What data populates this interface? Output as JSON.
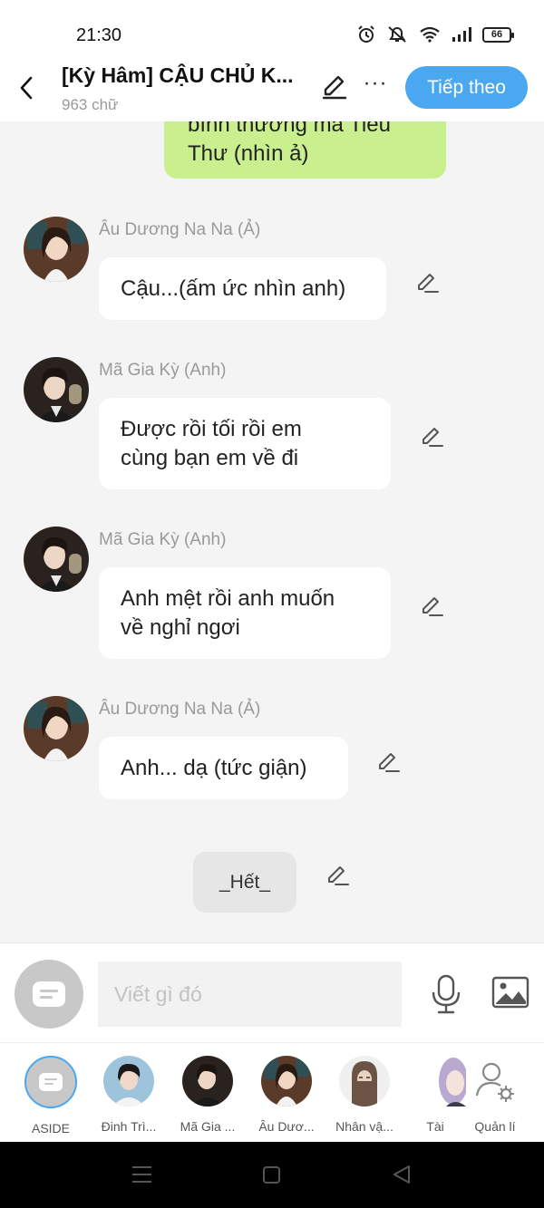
{
  "status_bar": {
    "time": "21:30",
    "battery": "66"
  },
  "header": {
    "title": "[Kỳ Hâm] CẬU CHỦ K...",
    "subtitle": "963 chữ",
    "next_label": "Tiếp theo"
  },
  "chat": {
    "partial_bubble_text_line1": "bình thường mà Tiểu",
    "partial_bubble_text_line2": "Thư (nhìn ả)",
    "messages": [
      {
        "name": "Âu Dương Na Na (Ả)",
        "text": "Cậu...(ấm ức nhìn anh)"
      },
      {
        "name": "Mã Gia Kỳ (Anh)",
        "text_line1": "Được rồi tối rồi em",
        "text_line2": "cùng bạn em về đi"
      },
      {
        "name": "Mã Gia Kỳ (Anh)",
        "text_line1": "Anh mệt rồi anh muốn",
        "text_line2": "về nghỉ ngơi"
      },
      {
        "name": "Âu Dương Na Na (Ả)",
        "text": "Anh... dạ (tức giận)"
      }
    ],
    "end_label": "_Hết_"
  },
  "input": {
    "placeholder": "Viết gì đó"
  },
  "characters": [
    {
      "label": "ASIDE"
    },
    {
      "label": "Đinh Trì..."
    },
    {
      "label": "Mã Gia ..."
    },
    {
      "label": "Âu Dươ..."
    },
    {
      "label": "Nhân vậ..."
    },
    {
      "label": "Tài"
    },
    {
      "label": "Quản lí"
    }
  ],
  "colors": {
    "accent": "#4aa8f0",
    "right_bubble": "#c9ef8f",
    "background": "#f4f4f4"
  },
  "icons": [
    "back-arrow-icon",
    "pencil-icon",
    "more-icon",
    "chat-icon",
    "mic-icon",
    "image-icon",
    "user-settings-icon"
  ]
}
